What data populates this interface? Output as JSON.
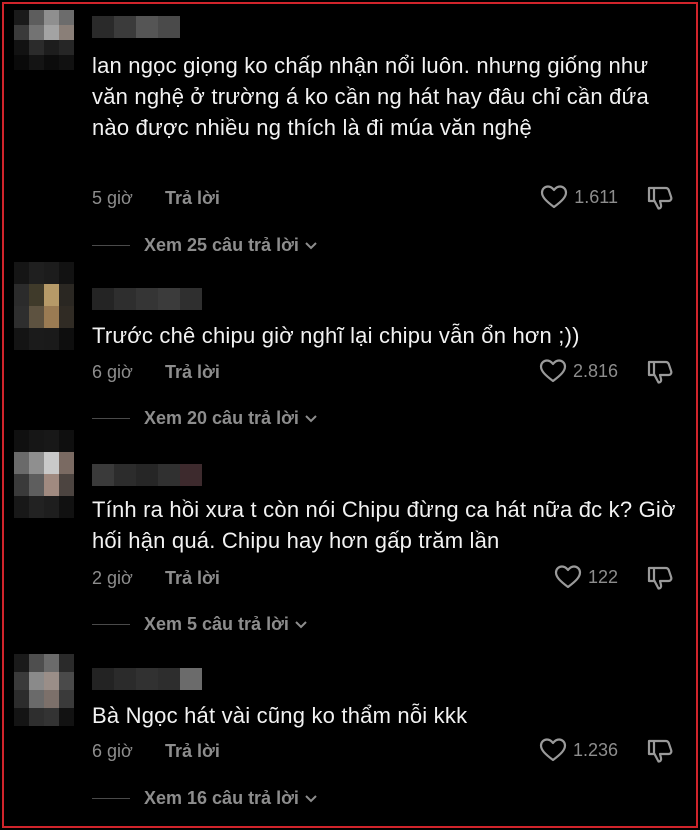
{
  "comments": [
    {
      "text": "lan ngọc giọng ko chấp nhận nổi luôn. nhưng giống như văn nghệ ở trường á ko cần ng hát hay đâu chỉ cần đứa nào được nhiều ng thích là đi múa văn nghệ",
      "time": "5 giờ",
      "reply_label": "Trả lời",
      "likes": "1.611",
      "view_replies": "Xem 25 câu trả lời"
    },
    {
      "text": "Trước chê chipu giờ nghĩ lại chipu vẫn ổn hơn ;))",
      "time": "6 giờ",
      "reply_label": "Trả lời",
      "likes": "2.816",
      "view_replies": "Xem 20 câu trả lời"
    },
    {
      "text": "Tính ra hồi xưa t còn nói Chipu đừng ca hát nữa đc k? Giờ hối hận quá. Chipu hay hơn gấp trăm lần",
      "time": "2 giờ",
      "reply_label": "Trả lời",
      "likes": "122",
      "view_replies": "Xem 5 câu trả lời"
    },
    {
      "text": "Bà Ngọc hát vài cũng ko thẩm nỗi kkk",
      "time": "6 giờ",
      "reply_label": "Trả lời",
      "likes": "1.236",
      "view_replies": "Xem 16 câu trả lời"
    }
  ],
  "icons": {
    "like": "heart-outline-icon",
    "dislike": "thumbs-down-icon",
    "expand": "chevron-down-icon"
  },
  "colors": {
    "background": "#000000",
    "text": "#f2f2f2",
    "muted": "#8d8d8d",
    "frame": "#d0242b"
  }
}
